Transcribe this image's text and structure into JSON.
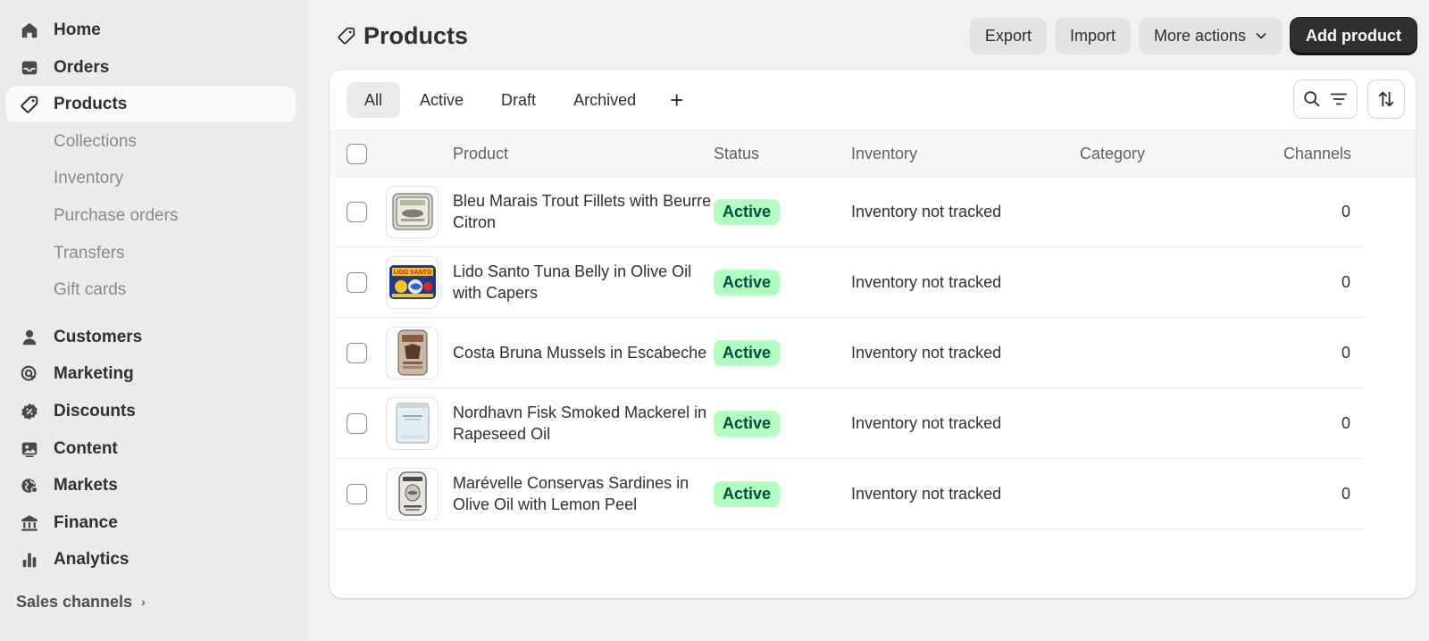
{
  "sidebar": {
    "main_items": [
      {
        "label": "Home",
        "icon": "home-icon"
      },
      {
        "label": "Orders",
        "icon": "inbox-icon"
      },
      {
        "label": "Products",
        "icon": "tag-icon"
      }
    ],
    "product_subitems": [
      "Collections",
      "Inventory",
      "Purchase orders",
      "Transfers",
      "Gift cards"
    ],
    "secondary_items": [
      {
        "label": "Customers",
        "icon": "person-icon"
      },
      {
        "label": "Marketing",
        "icon": "target-icon"
      },
      {
        "label": "Discounts",
        "icon": "discount-icon"
      },
      {
        "label": "Content",
        "icon": "image-icon"
      },
      {
        "label": "Markets",
        "icon": "globe-icon"
      },
      {
        "label": "Finance",
        "icon": "bank-icon"
      },
      {
        "label": "Analytics",
        "icon": "bar-chart-icon"
      }
    ],
    "sales_channels_label": "Sales channels"
  },
  "header": {
    "title": "Products",
    "export_label": "Export",
    "import_label": "Import",
    "more_actions_label": "More actions",
    "add_product_label": "Add product"
  },
  "tabs": [
    "All",
    "Active",
    "Draft",
    "Archived"
  ],
  "table": {
    "headers": {
      "product": "Product",
      "status": "Status",
      "inventory": "Inventory",
      "category": "Category",
      "channels": "Channels"
    },
    "rows": [
      {
        "name": "Bleu Marais Trout Fillets with Beurre Citron",
        "status": "Active",
        "inventory": "Inventory not tracked",
        "category": "",
        "channels": "0"
      },
      {
        "name": "Lido Santo Tuna Belly in Olive Oil with Capers",
        "status": "Active",
        "inventory": "Inventory not tracked",
        "category": "",
        "channels": "0"
      },
      {
        "name": "Costa Bruna Mussels in Escabeche",
        "status": "Active",
        "inventory": "Inventory not tracked",
        "category": "",
        "channels": "0"
      },
      {
        "name": "Nordhavn Fisk Smoked Mackerel in Rapeseed Oil",
        "status": "Active",
        "inventory": "Inventory not tracked",
        "category": "",
        "channels": "0"
      },
      {
        "name": "Marévelle Conservas Sardines in Olive Oil with Lemon Peel",
        "status": "Active",
        "inventory": "Inventory not tracked",
        "category": "",
        "channels": "0"
      }
    ]
  },
  "colors": {
    "active_badge_bg": "#affebf",
    "active_badge_text": "#014b40",
    "primary_button": "#303030"
  }
}
